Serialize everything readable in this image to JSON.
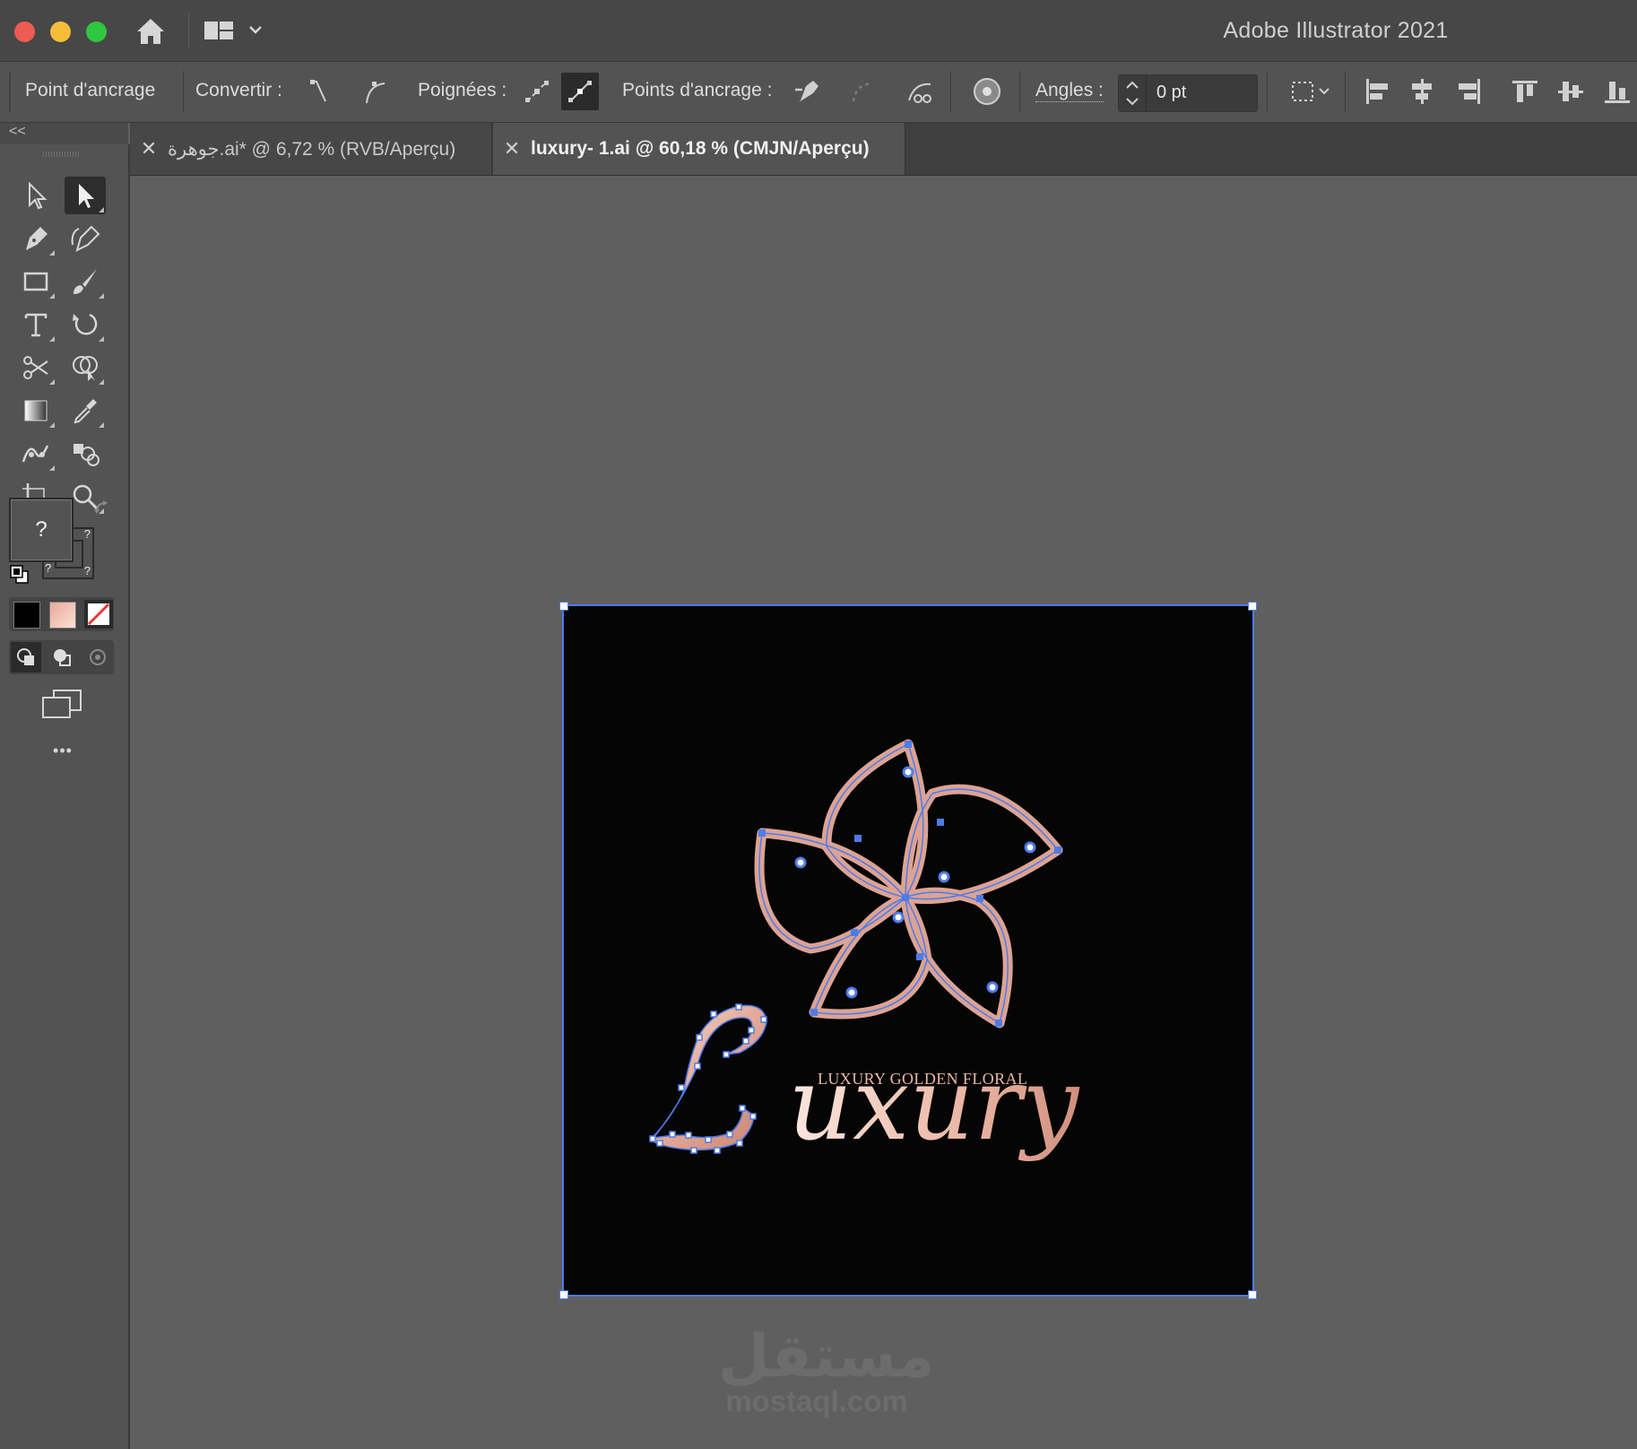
{
  "window": {
    "title": "Adobe Illustrator 2021"
  },
  "control_bar": {
    "context_label": "Point d'ancrage",
    "convert_label": "Convertir :",
    "handles_label": "Poignées :",
    "anchor_points_label": "Points d'ancrage :",
    "angles_label": "Angles :",
    "angles_value": "0 pt"
  },
  "tabs": [
    {
      "label": "جوهرة.ai* @ 6,72 % (RVB/Aperçu)",
      "active": false
    },
    {
      "label": "luxury- 1.ai @ 60,18 % (CMJN/Aperçu)",
      "active": true
    }
  ],
  "toolbar": {
    "collapse_label": "<<",
    "fill_stroke_unknown": "?",
    "stroke_unknown_a": "?",
    "stroke_unknown_b": "?",
    "stroke_unknown_c": "?",
    "more_tools": "•••"
  },
  "artwork": {
    "wordmark": "Luxury",
    "tagline": "LUXURY GOLDEN FLORAL",
    "accent_color": "#dca394",
    "selection_color": "#4f7be8"
  },
  "watermark": {
    "arabic": "مستقل",
    "latin": "mostaql.com"
  }
}
